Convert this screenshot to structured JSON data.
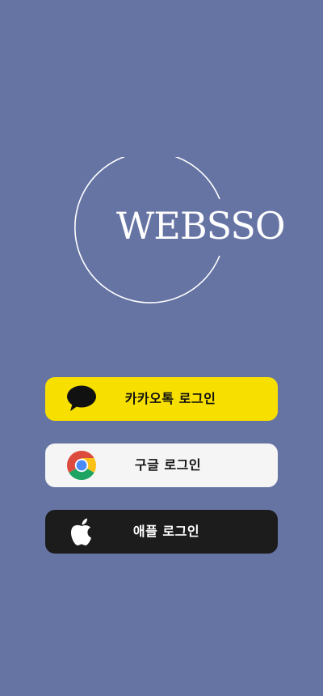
{
  "brand": {
    "logo_text": "WEBSSO"
  },
  "login_buttons": [
    {
      "label": "카카오톡 로그인",
      "icon": "kakao-speech-bubble-icon",
      "bg": "#f7df00",
      "fg": "#111111"
    },
    {
      "label": "구글 로그인",
      "icon": "chrome-icon",
      "bg": "#f5f5f5",
      "fg": "#111111"
    },
    {
      "label": "애플 로그인",
      "icon": "apple-icon",
      "bg": "#1c1c1c",
      "fg": "#ffffff"
    }
  ],
  "colors": {
    "background": "#6674a4",
    "logo": "#ffffff"
  }
}
